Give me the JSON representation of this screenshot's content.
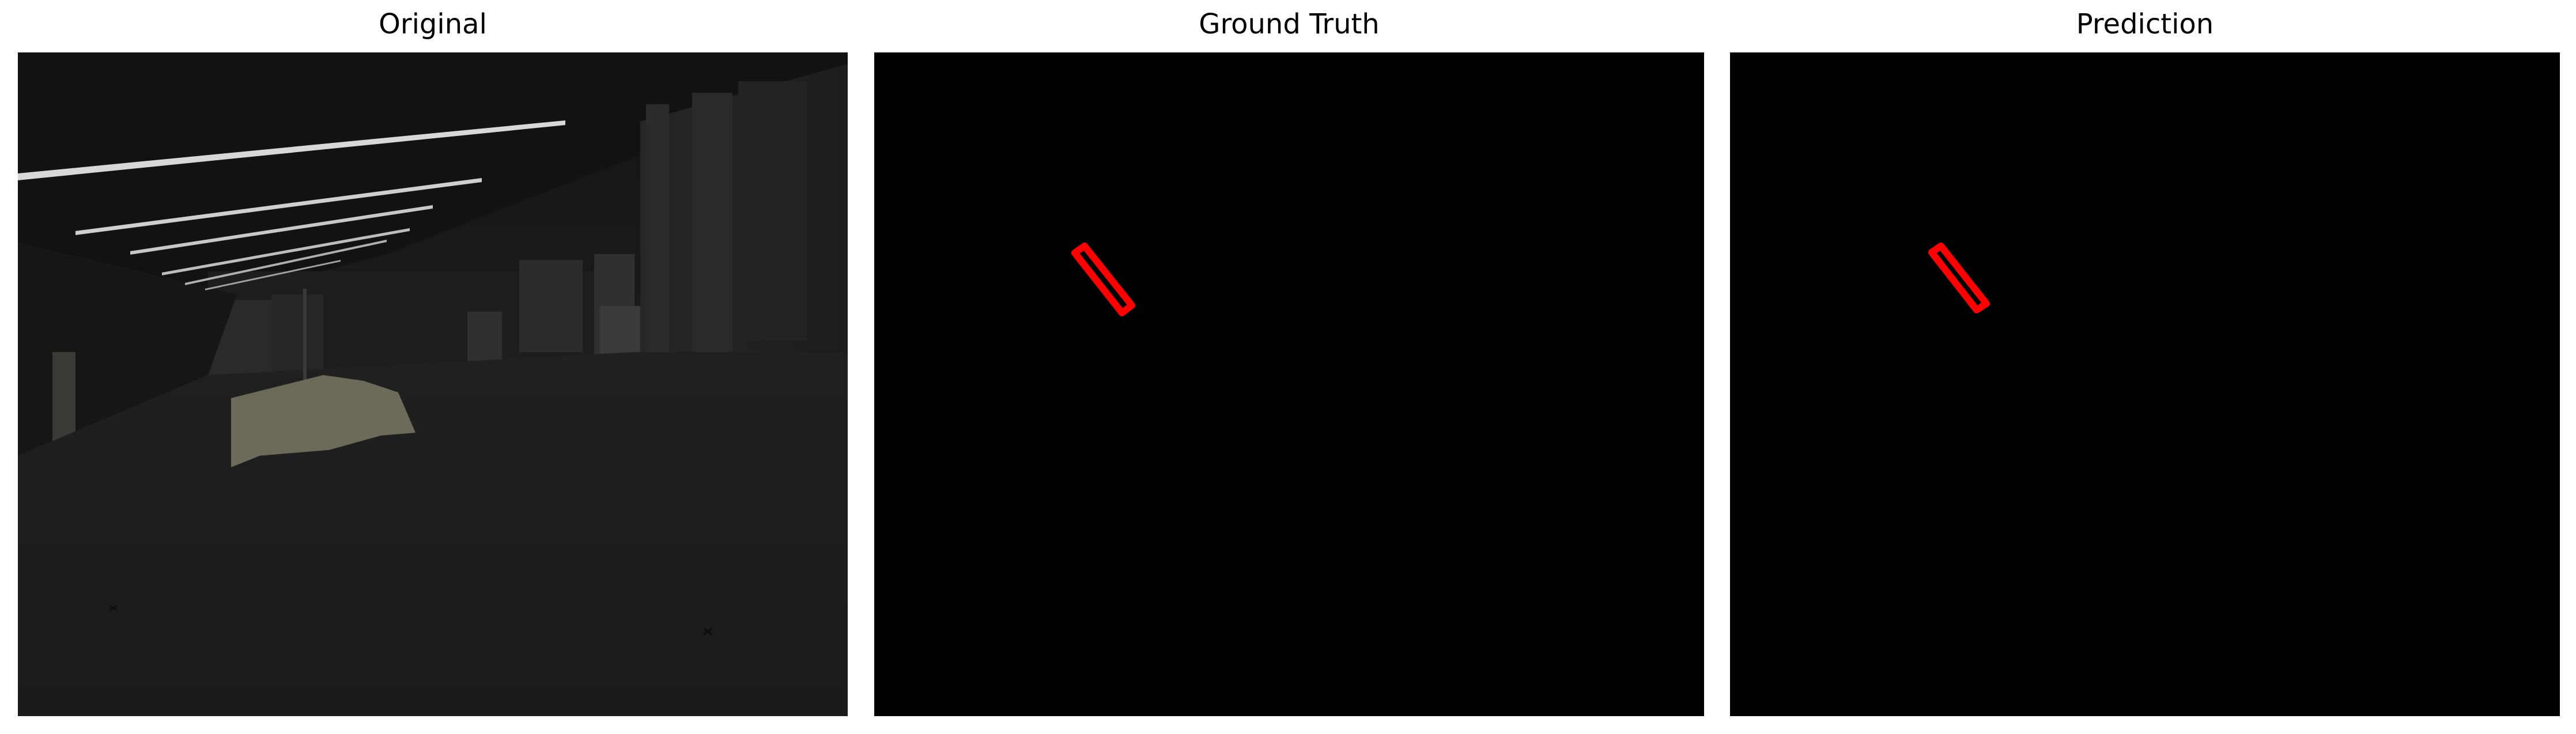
{
  "panels": [
    {
      "title": "Original"
    },
    {
      "title": "Ground Truth"
    },
    {
      "title": "Prediction"
    }
  ],
  "colors": {
    "background": "#ffffff",
    "mask_background": "#000000",
    "mask_outline": "#ff0000"
  }
}
